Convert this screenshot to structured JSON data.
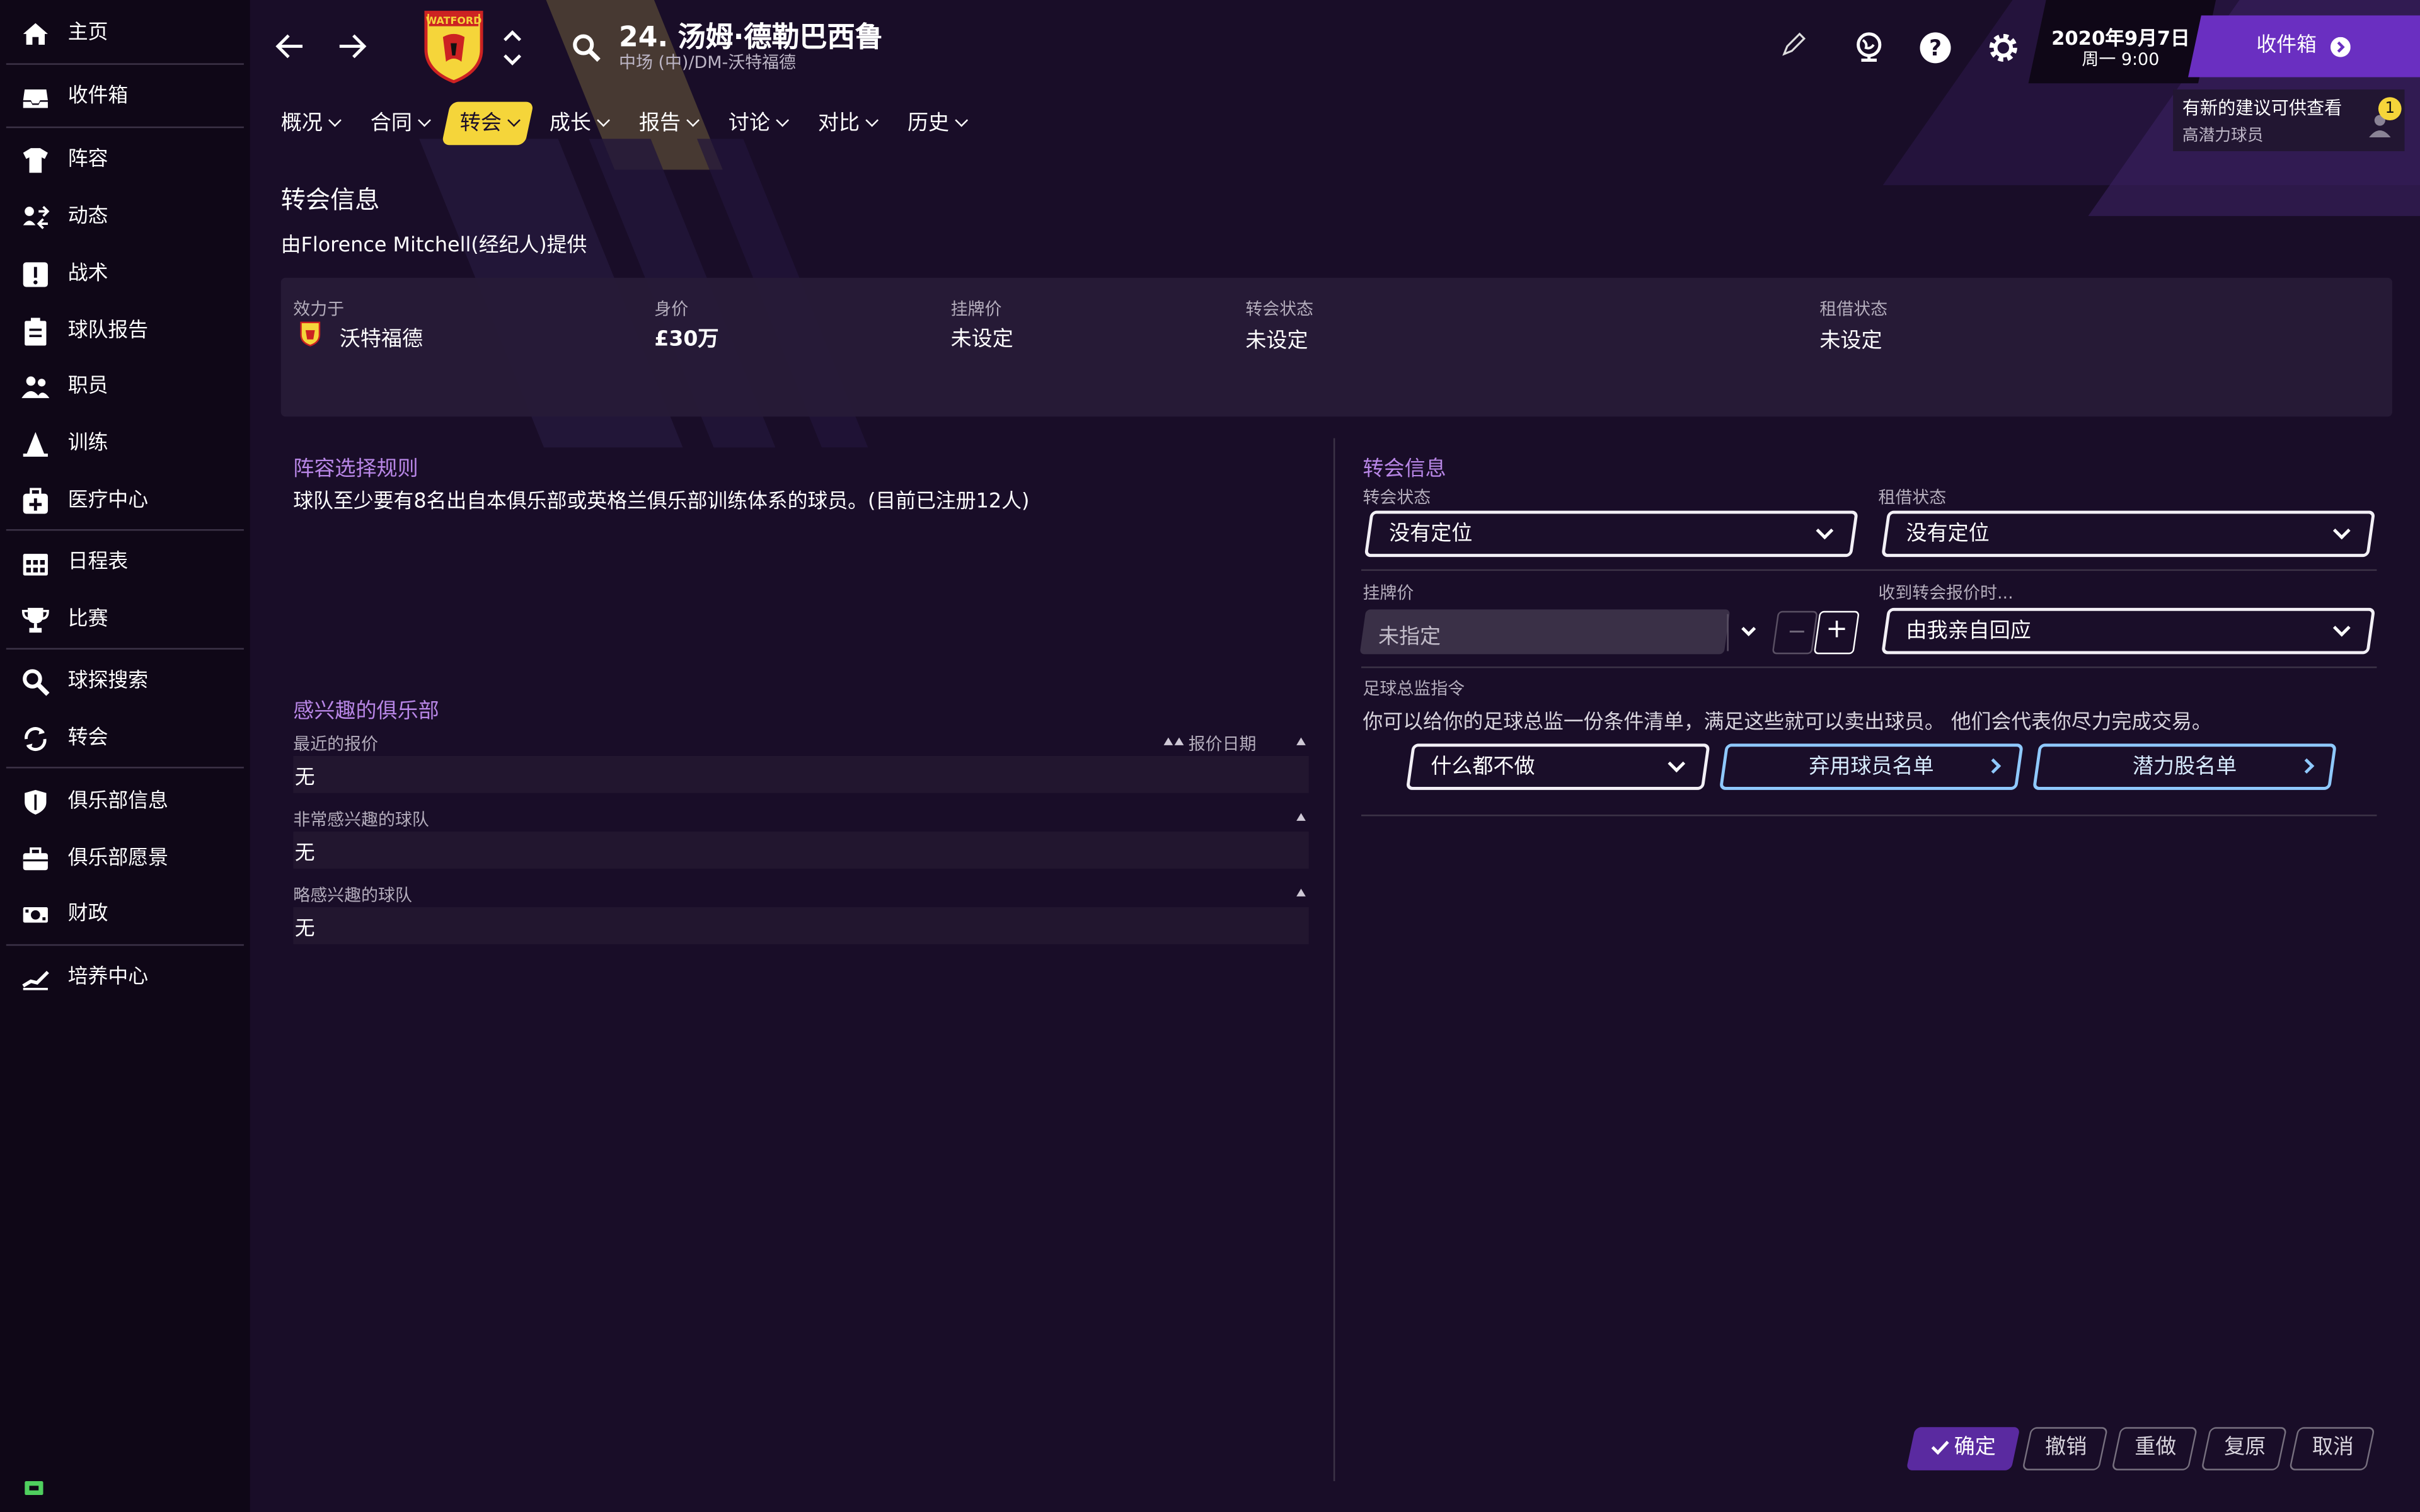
{
  "sidebar": {
    "items": [
      {
        "label": "主页",
        "icon": "home-icon"
      },
      {
        "label": "收件箱",
        "icon": "inbox-icon"
      },
      {
        "label": "阵容",
        "icon": "jersey-icon"
      },
      {
        "label": "动态",
        "icon": "dynamics-icon"
      },
      {
        "label": "战术",
        "icon": "tactics-icon"
      },
      {
        "label": "球队报告",
        "icon": "clipboard-icon"
      },
      {
        "label": "职员",
        "icon": "staff-icon"
      },
      {
        "label": "训练",
        "icon": "training-icon"
      },
      {
        "label": "医疗中心",
        "icon": "medical-icon"
      },
      {
        "label": "日程表",
        "icon": "calendar-icon"
      },
      {
        "label": "比赛",
        "icon": "trophy-icon"
      },
      {
        "label": "球探搜索",
        "icon": "search-icon"
      },
      {
        "label": "转会",
        "icon": "transfer-icon"
      },
      {
        "label": "俱乐部信息",
        "icon": "shield-icon"
      },
      {
        "label": "俱乐部愿景",
        "icon": "briefcase-icon"
      },
      {
        "label": "财政",
        "icon": "money-icon"
      },
      {
        "label": "培养中心",
        "icon": "development-icon"
      }
    ]
  },
  "header": {
    "player_title": "24. 汤姆·德勒巴西鲁",
    "player_subtitle": "中场 (中)/DM-沃特福德",
    "club_badge_text": "WATFORD",
    "date": "2020年9月7日",
    "time": "周一 9:00",
    "inbox_button": "收件箱",
    "notification_text": "有新的建议可供查看",
    "notification_sub": "高潜力球员",
    "notification_count": "1"
  },
  "tabs": [
    {
      "label": "概况",
      "active": false
    },
    {
      "label": "合同",
      "active": false
    },
    {
      "label": "转会",
      "active": true
    },
    {
      "label": "成长",
      "active": false
    },
    {
      "label": "报告",
      "active": false
    },
    {
      "label": "讨论",
      "active": false
    },
    {
      "label": "对比",
      "active": false
    },
    {
      "label": "历史",
      "active": false
    }
  ],
  "transfer_info": {
    "title": "转会信息",
    "provided_by": "由Florence Mitchell(经纪人)提供",
    "plays_for_label": "效力于",
    "plays_for_value": "沃特福德",
    "value_label": "身价",
    "value_value": "£30万",
    "asking_label": "挂牌价",
    "asking_value": "未设定",
    "transfer_status_label": "转会状态",
    "transfer_status_value": "未设定",
    "loan_status_label": "租借状态",
    "loan_status_value": "未设定"
  },
  "squad_rules": {
    "title": "阵容选择规则",
    "text": "球队至少要有8名出自本俱乐部或英格兰俱乐部训练体系的球员。(目前已注册12人)"
  },
  "interested_clubs": {
    "title": "感兴趣的俱乐部",
    "recent_offers_label": "最近的报价",
    "offer_date_label": "报价日期",
    "recent_offers_value": "无",
    "very_interested_label": "非常感兴趣的球队",
    "very_interested_value": "无",
    "slightly_interested_label": "略感兴趣的球队",
    "slightly_interested_value": "无"
  },
  "transfer_form": {
    "title": "转会信息",
    "transfer_status_label": "转会状态",
    "transfer_status_value": "没有定位",
    "loan_status_label": "租借状态",
    "loan_status_value": "没有定位",
    "asking_price_label": "挂牌价",
    "asking_price_placeholder": "未指定",
    "on_offer_label": "收到转会报价时...",
    "on_offer_value": "由我亲自回应",
    "dof_label": "足球总监指令",
    "dof_text": "你可以给你的足球总监一份条件清单，满足这些就可以卖出球员。 他们会代表你尽力完成交易。",
    "dof_action": "什么都不做",
    "release_list_button": "弃用球员名单",
    "hot_prospect_button": "潜力股名单"
  },
  "footer": {
    "confirm": "确定",
    "undo": "撤销",
    "redo": "重做",
    "restore": "复原",
    "cancel": "取消"
  },
  "colors": {
    "accent_yellow": "#f5d53a",
    "accent_purple": "#6a2fc1",
    "link_purple": "#b886e6",
    "link_blue": "#8fc9ff"
  }
}
